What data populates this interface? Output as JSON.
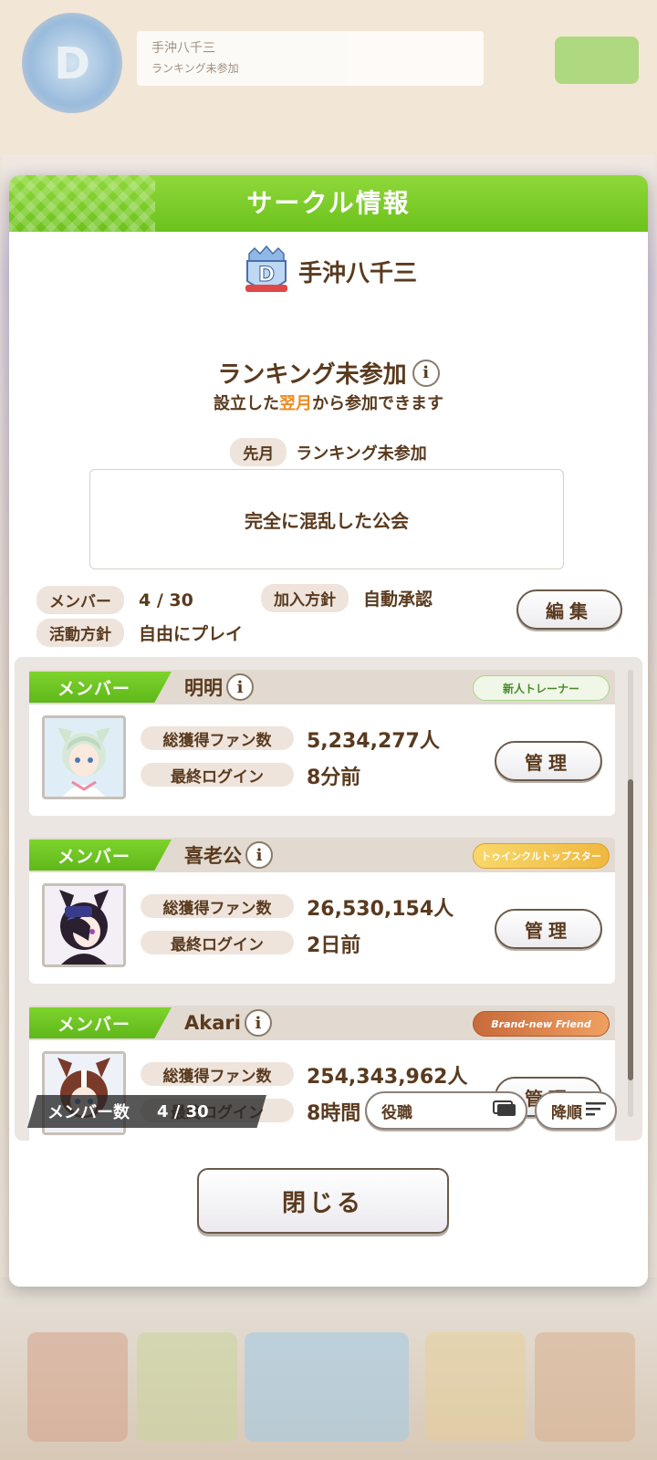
{
  "background": {
    "header_circle_name": "手沖八千三",
    "header_circle_status": "ランキング未参加"
  },
  "modal": {
    "title": "サークル情報",
    "circle_name": "手沖八千三",
    "ranking_status": "ランキング未参加",
    "ranking_note_prefix": "設立した",
    "ranking_note_highlight": "翌月",
    "ranking_note_suffix": "から参加できます",
    "last_month_label": "先月",
    "last_month_value": "ランキング未参加",
    "description": "完全に混乱した公会",
    "members_label": "メンバー",
    "members_value": "4 / 30",
    "join_policy_label": "加入方針",
    "join_policy_value": "自動承認",
    "activity_policy_label": "活動方針",
    "activity_policy_value": "自由にプレイ",
    "edit_label": "編集",
    "close_label": "閉じる"
  },
  "member_list": {
    "members": [
      {
        "role": "メンバー",
        "name": "明明",
        "title_badge": "新人トレーナー",
        "fans_label": "総獲得ファン数",
        "fans_value": "5,234,277人",
        "login_label": "最終ログイン",
        "login_value": "8分前",
        "manage_label": "管理"
      },
      {
        "role": "メンバー",
        "name": "喜老公",
        "title_badge": "トゥインクルトップスター",
        "fans_label": "総獲得ファン数",
        "fans_value": "26,530,154人",
        "login_label": "最終ログイン",
        "login_value": "2日前",
        "manage_label": "管理"
      },
      {
        "role": "メンバー",
        "name": "Akari",
        "title_badge": "Brand-new Friend",
        "fans_label": "総獲得ファン数",
        "fans_value": "254,343,962人",
        "login_label": "最終ログイン",
        "login_value": "8時間",
        "manage_label": "管理"
      }
    ],
    "count_label": "メンバー数",
    "count_value": "4 / 30",
    "sort_key_label": "役職",
    "sort_order_label": "降順"
  },
  "colors": {
    "header_green": "#6cc21c",
    "text_brown": "#5a3a1e",
    "highlight_orange": "#f08a1c"
  },
  "icons": [
    "info-icon",
    "circle-emblem-icon",
    "filter-icon",
    "sort-icon"
  ]
}
